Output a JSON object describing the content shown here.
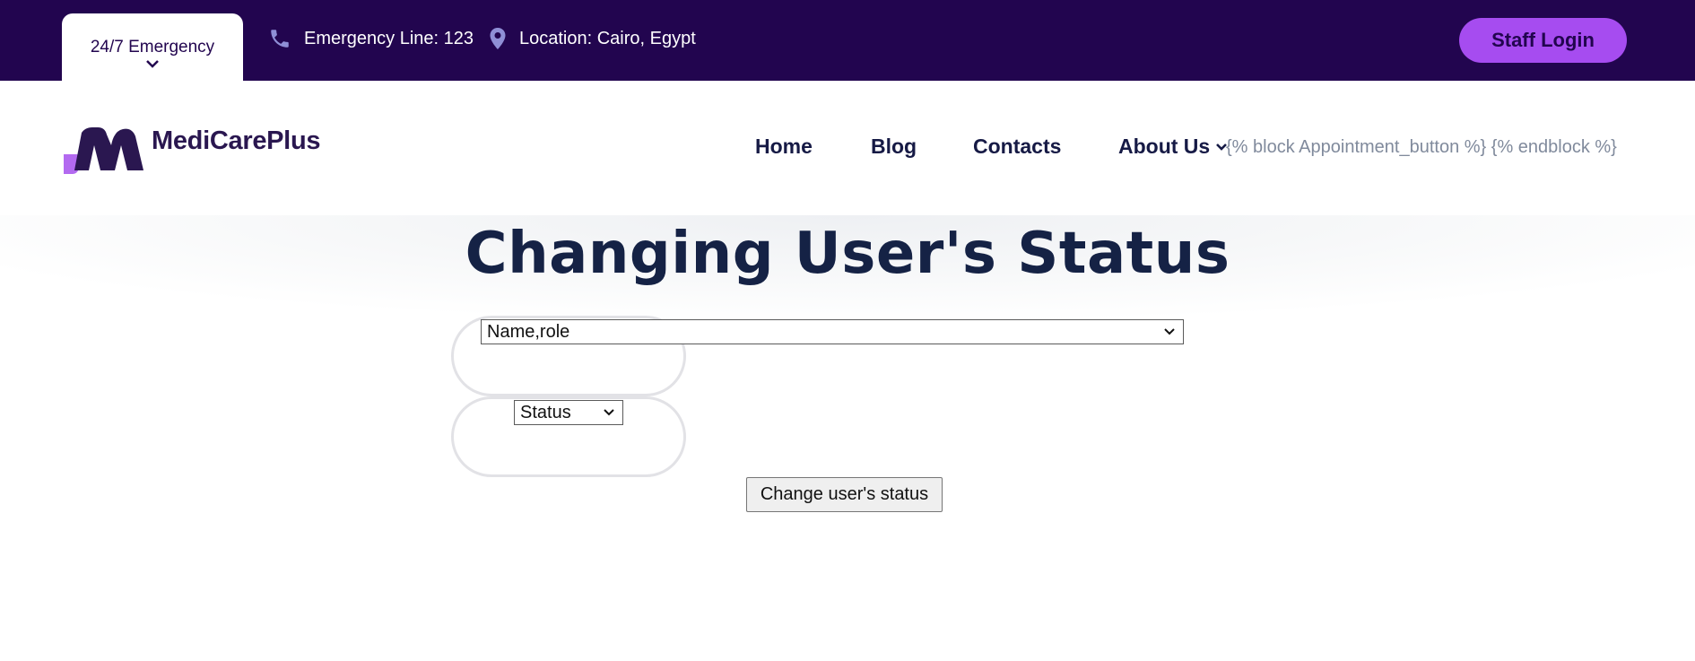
{
  "topbar": {
    "emergency_label": "24/7 Emergency",
    "emergency_line": "Emergency Line: 123",
    "location": "Location: Cairo, Egypt",
    "staff_login": "Staff Login"
  },
  "header": {
    "logo_text": "MediCarePlus",
    "nav": [
      "Home",
      "Blog",
      "Contacts",
      "About Us"
    ],
    "template_text": "{% block Appointment_button %} {% endblock %}"
  },
  "main": {
    "title": "Changing User's Status",
    "user_select_value": "Name,role",
    "status_select_value": "Status",
    "submit_label": "Change user's status"
  },
  "colors": {
    "topbar_bg": "#22054f",
    "accent": "#a64cf0",
    "nav_text": "#161a45",
    "title_text": "#152245",
    "template_text": "#808a9c"
  },
  "icons": [
    "chevron-down-icon",
    "phone-icon",
    "location-pin-icon"
  ]
}
